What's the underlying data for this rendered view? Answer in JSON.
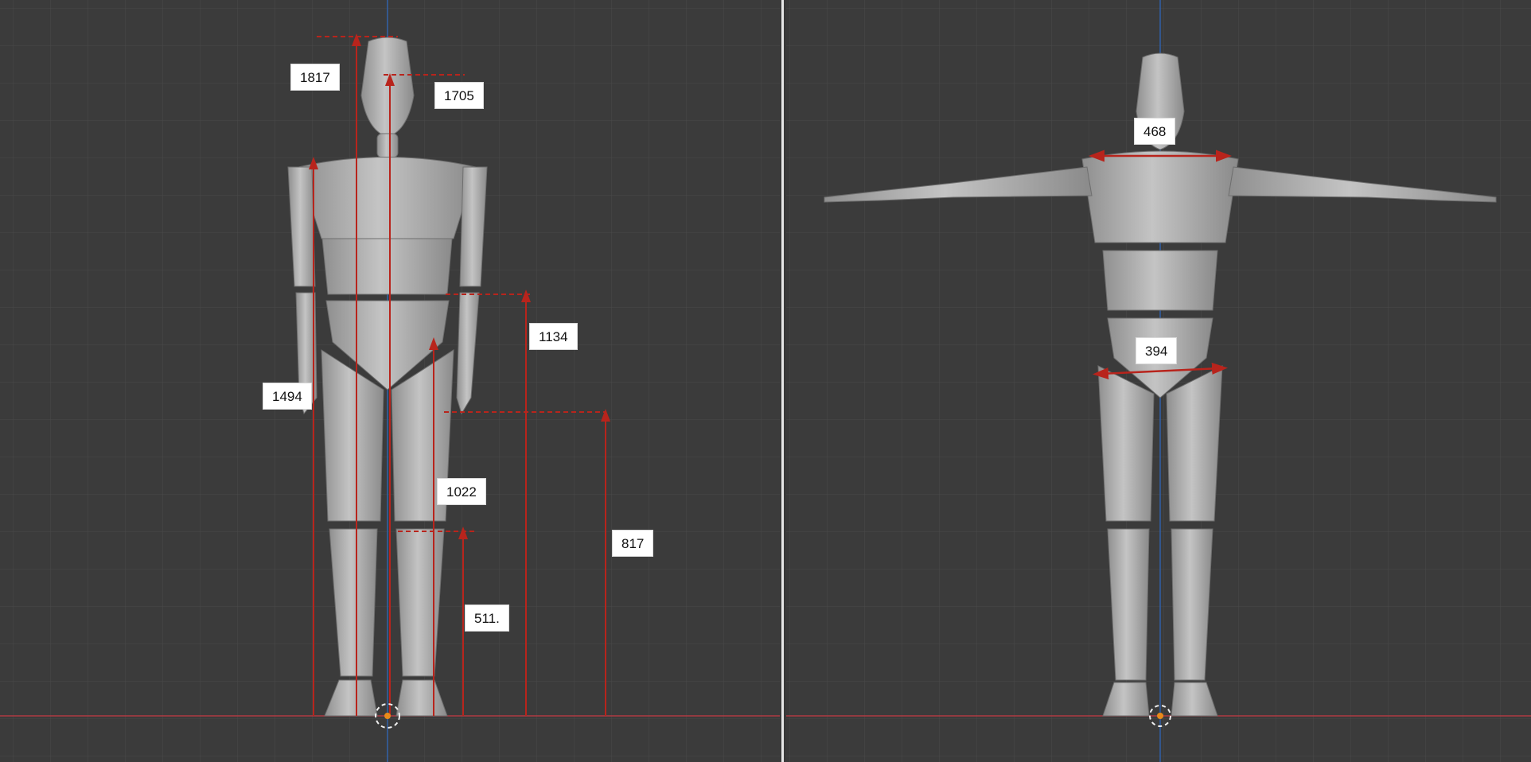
{
  "colors": {
    "viewport_bg": "#3b3b3b",
    "grid_line": "#4a4a4a",
    "x_axis": "#b03a43",
    "y_axis": "#2f5fa8",
    "measure": "#b8241c",
    "mannequin": "#b5b5b5"
  },
  "left_view": {
    "measurements": {
      "total_height": "1817",
      "eye_height": "1705",
      "shoulder_height": "1494",
      "hip_height": "1134",
      "crotch_height": "1022",
      "wrist_height": "817",
      "knee_height": "511."
    }
  },
  "right_view": {
    "measurements": {
      "shoulder_width": "468",
      "hip_width": "394"
    }
  }
}
